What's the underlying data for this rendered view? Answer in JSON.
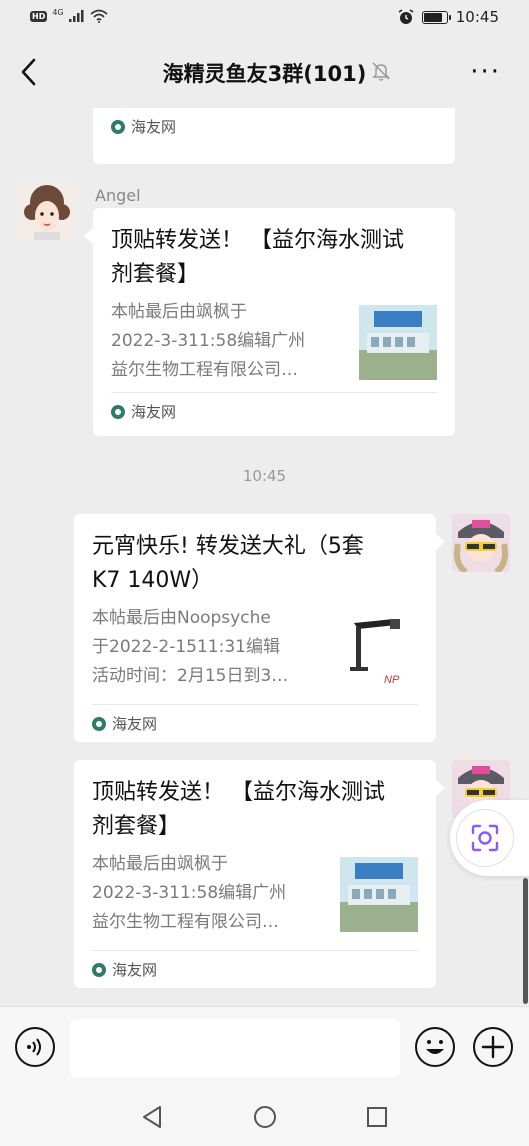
{
  "status_bar": {
    "hd": "HD",
    "network": "4G",
    "time": "10:45",
    "battery_level": 0.85
  },
  "nav": {
    "title": "海精灵鱼友3群(101)",
    "back_icon": "chevron-left-icon",
    "mute_icon": "bell-off-icon",
    "more_icon": "more-dots-icon"
  },
  "messages": [
    {
      "type": "link_card_partial",
      "source": "海友网"
    },
    {
      "type": "link_card",
      "side": "left",
      "sender": "Angel",
      "title_lines": [
        "顶贴转发送！ 【益尔海水测试",
        "剂套餐】"
      ],
      "desc_lines": [
        "本帖最后由飒枫于",
        "2022-3-311:58编辑广州",
        "益尔生物工程有限公司…"
      ],
      "thumb_caption": "公司全景 留学人员创业园",
      "source": "海友网"
    },
    {
      "type": "time",
      "time": "10:45"
    },
    {
      "type": "link_card",
      "side": "right",
      "title_lines": [
        "元宵快乐! 转发送大礼（5套",
        "K7  140W）"
      ],
      "desc_lines": [
        "本帖最后由Noopsyche",
        "于2022-2-1511:31编辑",
        "活动时间：2月15日到3…"
      ],
      "thumb_caption": "NP",
      "source": "海友网"
    },
    {
      "type": "link_card",
      "side": "right",
      "title_lines": [
        "顶贴转发送！ 【益尔海水测试",
        "剂套餐】"
      ],
      "desc_lines": [
        "本帖最后由飒枫于",
        "2022-3-311:58编辑广州",
        "益尔生物工程有限公司…"
      ],
      "thumb_caption": "公司全景 留学人员创业园",
      "source": "海友网"
    }
  ],
  "input_bar": {
    "voice_icon": "voice-icon",
    "input_value": "",
    "emoji_icon": "emoji-icon",
    "plus_icon": "plus-icon"
  },
  "floating": {
    "icon": "screen-recognition-icon"
  },
  "system_nav": {
    "back_icon": "triangle-back-icon",
    "home_icon": "circle-home-icon",
    "recent_icon": "square-recent-icon"
  },
  "colors": {
    "background": "#ededed",
    "bubble": "#ffffff",
    "source_icon": "#2f7b68",
    "float_accent": "#8a5cf5"
  }
}
